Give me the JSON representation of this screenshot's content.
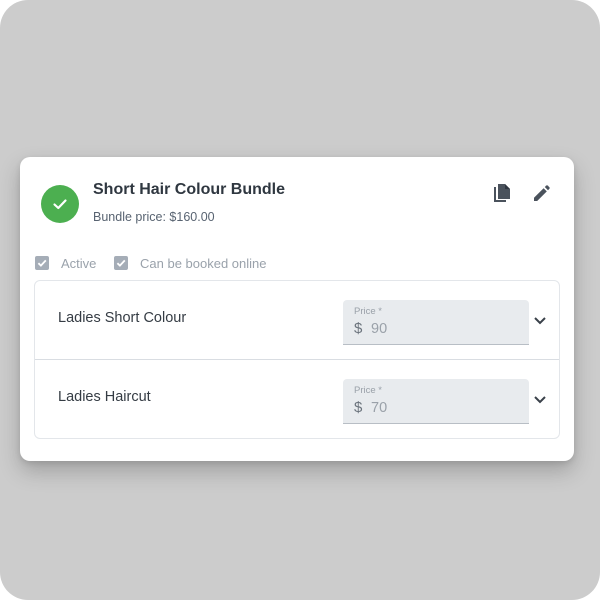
{
  "bundle": {
    "title": "Short Hair Colour Bundle",
    "subtitle": "Bundle price: $160.00",
    "status_icon": "check-circle-icon",
    "status_color": "#4caf50"
  },
  "actions": {
    "copy_icon": "copy-icon",
    "edit_icon": "pencil-icon"
  },
  "options": [
    {
      "label": "Active",
      "checked": true
    },
    {
      "label": "Can be booked online",
      "checked": true
    }
  ],
  "items": [
    {
      "name": "Ladies Short Colour",
      "price_label": "Price *",
      "currency": "$",
      "price": "90"
    },
    {
      "name": "Ladies Haircut",
      "price_label": "Price *",
      "currency": "$",
      "price": "70"
    }
  ]
}
